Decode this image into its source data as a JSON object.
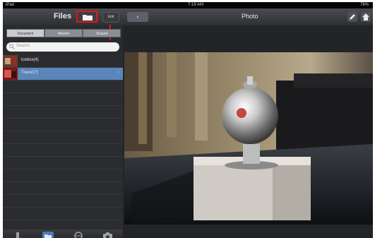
{
  "status_bar": {
    "carrier": "iPad",
    "time": "7:19 AM",
    "battery": "78%"
  },
  "left_panel": {
    "title": "Files",
    "edit_label": "Edit",
    "segments": [
      "Document",
      "Albums",
      "Shared"
    ],
    "search_placeholder": "Search",
    "rows": [
      {
        "label": "icebox(4)",
        "selected": false
      },
      {
        "label": "Travel(7)",
        "selected": true
      }
    ],
    "toolbar_icons": [
      "transfer-icon",
      "folder-icon",
      "globe-icon",
      "camera-icon"
    ]
  },
  "right_panel": {
    "title": "Photo",
    "back_label": "‹"
  },
  "colors": {
    "selected_row": "#5a86b9",
    "highlight": "#e01818"
  }
}
